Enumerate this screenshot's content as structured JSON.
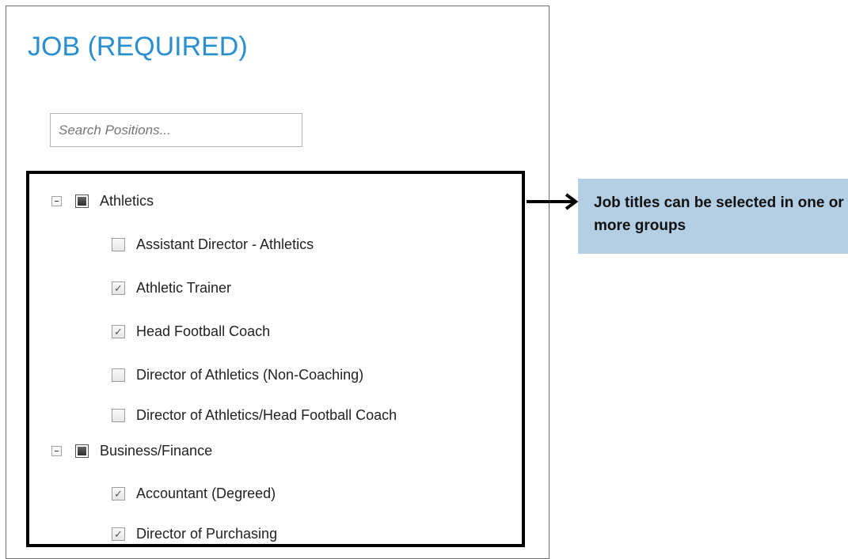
{
  "header": {
    "title": "JOB (REQUIRED)"
  },
  "search": {
    "placeholder": "Search Positions..."
  },
  "tree": {
    "groups": [
      {
        "label": "Athletics",
        "expanded": true,
        "state": "partial",
        "items": [
          {
            "label": "Assistant Director - Athletics",
            "checked": false
          },
          {
            "label": "Athletic Trainer",
            "checked": true
          },
          {
            "label": "Head Football Coach",
            "checked": true
          },
          {
            "label": "Director of Athletics (Non-Coaching)",
            "checked": false
          },
          {
            "label": "Director of Athletics/Head Football Coach",
            "checked": false
          }
        ]
      },
      {
        "label": "Business/Finance",
        "expanded": true,
        "state": "partial",
        "items": [
          {
            "label": "Accountant (Degreed)",
            "checked": true
          },
          {
            "label": "Director of Purchasing",
            "checked": true
          }
        ]
      }
    ]
  },
  "callout": {
    "text": "Job titles can be selected in one or more groups"
  },
  "colors": {
    "title": "#2a8fd0",
    "callout_bg": "#b4cee3",
    "highlight_border": "#000000"
  },
  "icons": {
    "expander": "collapse-minus-icon",
    "check": "checkmark-icon",
    "partial": "partial-square-icon",
    "arrow": "right-arrow-icon"
  }
}
